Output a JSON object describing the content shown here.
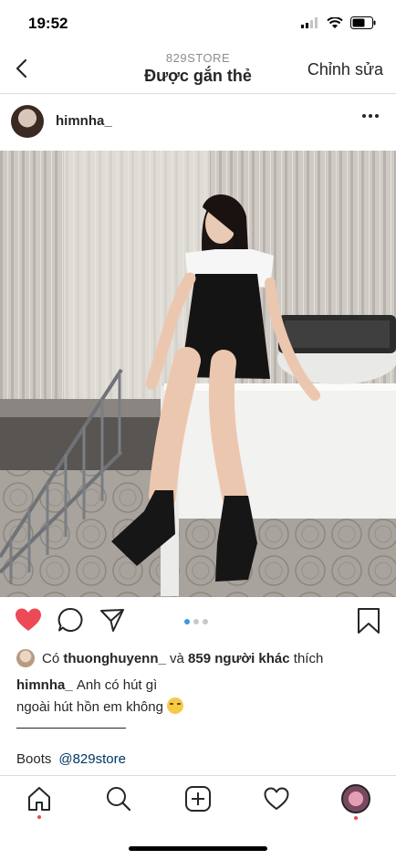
{
  "status_bar": {
    "time": "19:52"
  },
  "header": {
    "subtitle": "829STORE",
    "title": "Được gắn thẻ",
    "edit_label": "Chỉnh sửa"
  },
  "post": {
    "username": "himnha_",
    "likes": {
      "prefix": "Có",
      "user": "thuonghuyenn_",
      "and": "và",
      "others": "859 người khác",
      "suffix": "thích"
    },
    "caption": {
      "username": "himnha_",
      "line1": "Anh có hút gì",
      "line2": "ngoài hút hồn em không"
    },
    "tag_label": "Boots",
    "tag_mention": "@829store",
    "carousel": {
      "count": 3,
      "active": 1
    }
  },
  "colors": {
    "like": "#ed4956",
    "carousel_active": "#3897f0",
    "mention": "#003569"
  },
  "icons": [
    "back-icon",
    "more-icon",
    "heart-filled-icon",
    "comment-icon",
    "share-icon",
    "bookmark-icon",
    "home-icon",
    "search-icon",
    "add-icon",
    "activity-icon",
    "profile-icon"
  ]
}
